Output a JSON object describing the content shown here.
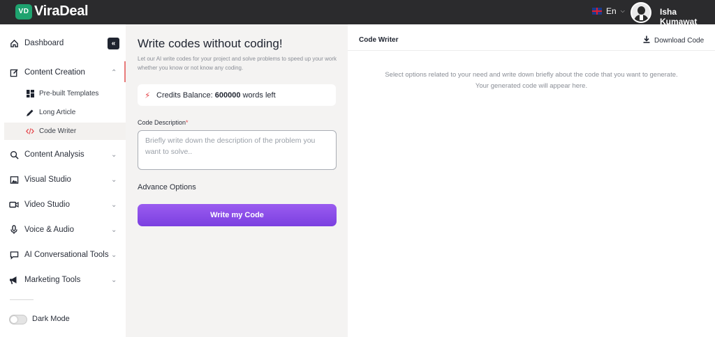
{
  "app": {
    "logo_badge": "VD",
    "logo_text": "ViraDeal",
    "language": "En",
    "user_name": "Isha Kumawat"
  },
  "sidebar": {
    "items": [
      {
        "label": "Dashboard",
        "icon": "home-icon"
      },
      {
        "label": "Content Creation",
        "icon": "edit-icon",
        "expanded": true
      },
      {
        "label": "Content Analysis",
        "icon": "search-icon"
      },
      {
        "label": "Visual Studio",
        "icon": "image-icon"
      },
      {
        "label": "Video Studio",
        "icon": "video-icon"
      },
      {
        "label": "Voice & Audio",
        "icon": "microphone-icon"
      },
      {
        "label": "AI Conversational Tools",
        "icon": "chat-icon"
      },
      {
        "label": "Marketing Tools",
        "icon": "megaphone-icon"
      }
    ],
    "sub_items": [
      {
        "label": "Pre-built Templates",
        "icon": "grid-icon"
      },
      {
        "label": "Long Article",
        "icon": "pen-icon"
      },
      {
        "label": "Code Writer",
        "icon": "code-icon",
        "active": true
      }
    ],
    "dark_mode_label": "Dark Mode"
  },
  "form": {
    "title": "Write codes without coding!",
    "subtitle": "Let our AI write codes for your project and solve problems to speed up your work whether you know or not know any coding.",
    "credits_label": "Credits Balance:",
    "credits_amount": "600000",
    "credits_suffix": "words left",
    "description_label": "Code Description",
    "description_required": "*",
    "description_placeholder": "Briefly write down the description of the problem you want to solve..",
    "advance_options": "Advance Options",
    "submit_label": "Write my Code"
  },
  "output": {
    "title": "Code Writer",
    "download_label": "Download Code",
    "empty_message": "Select options related to your need and write down briefly about the code that you want to generate. Your generated code will appear here."
  },
  "colors": {
    "topbar": "#2b2b2d",
    "brand_green": "#1ea36f",
    "accent_purple": "#8a4de8",
    "required_red": "#e5484d"
  }
}
